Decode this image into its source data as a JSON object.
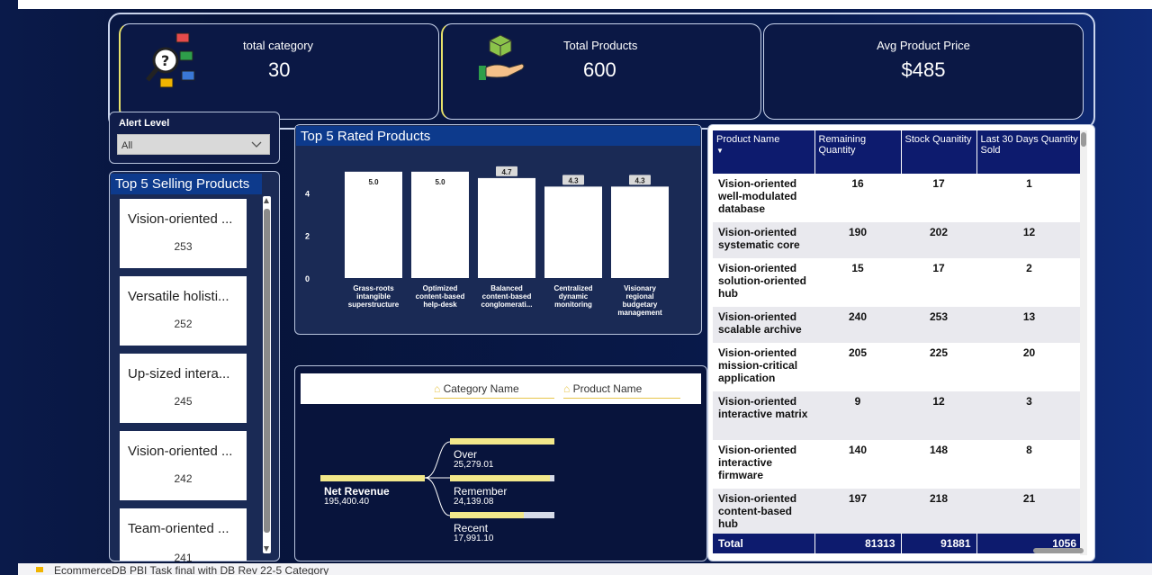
{
  "kpis": {
    "category": {
      "label": "total category",
      "value": "30",
      "icon": "category-search-icon"
    },
    "products": {
      "label": "Total Products",
      "value": "600",
      "icon": "product-hand-icon"
    },
    "price": {
      "label": "Avg Product Price",
      "value": "$485"
    }
  },
  "alert": {
    "label": "Alert Level",
    "selected": "All"
  },
  "selling": {
    "title": "Top 5 Selling Products",
    "items": [
      {
        "name": "Vision-oriented ...",
        "value": "253"
      },
      {
        "name": "Versatile holisti...",
        "value": "252"
      },
      {
        "name": "Up-sized intera...",
        "value": "245"
      },
      {
        "name": "Vision-oriented ...",
        "value": "242"
      },
      {
        "name": "Team-oriented ...",
        "value": "241"
      }
    ]
  },
  "chart_data": {
    "type": "bar",
    "title": "Top 5 Rated Products",
    "categories": [
      "Grass-roots intangible superstructure",
      "Optimized content-based help-desk",
      "Balanced content-based conglomerati...",
      "Centralized dynamic monitoring",
      "Visionary regional budgetary management"
    ],
    "values": [
      5.0,
      5.0,
      4.7,
      4.3,
      4.3
    ],
    "data_labels": [
      "5.0",
      "5.0",
      "4.7",
      "4.3",
      "4.3"
    ],
    "yticks": [
      "4",
      "2",
      "0"
    ],
    "ylim": [
      0,
      5.5
    ],
    "grid": false,
    "bar_color": "#ffffff",
    "background": "#1a2a55"
  },
  "tree": {
    "fields": [
      "Category Name",
      "Product Name"
    ],
    "root": {
      "label": "Net Revenue",
      "value": "195,400.40"
    },
    "children": [
      {
        "label": "Over",
        "value": "25,279.01",
        "fraction": 1.0
      },
      {
        "label": "Remember",
        "value": "24,139.08",
        "fraction": 0.955
      },
      {
        "label": "Recent",
        "value": "17,991.10",
        "fraction": 0.71
      }
    ]
  },
  "table": {
    "headers": [
      "Product Name",
      "Remaining Quantity",
      "Stock Quanitity",
      "Last 30 Days Quantity Sold"
    ],
    "rows": [
      [
        "Vision-oriented well-modulated database",
        "16",
        "17",
        "1"
      ],
      [
        "Vision-oriented systematic core",
        "190",
        "202",
        "12"
      ],
      [
        "Vision-oriented solution-oriented hub",
        "15",
        "17",
        "2"
      ],
      [
        "Vision-oriented scalable archive",
        "240",
        "253",
        "13"
      ],
      [
        "Vision-oriented mission-critical application",
        "205",
        "225",
        "20"
      ],
      [
        "Vision-oriented interactive matrix",
        "9",
        "12",
        "3"
      ],
      [
        "Vision-oriented interactive firmware",
        "140",
        "148",
        "8"
      ],
      [
        "Vision-oriented content-based hub",
        "197",
        "218",
        "21"
      ]
    ],
    "total": [
      "Total",
      "81313",
      "91881",
      "1056"
    ]
  },
  "footer": {
    "file_name": "EcommerceDB PBI Task final with DB Rev 22-5  Category"
  },
  "colors": {
    "accent": "#f2e88a",
    "header": "#0d1b6e",
    "title_bar": "#0d3a8c"
  }
}
